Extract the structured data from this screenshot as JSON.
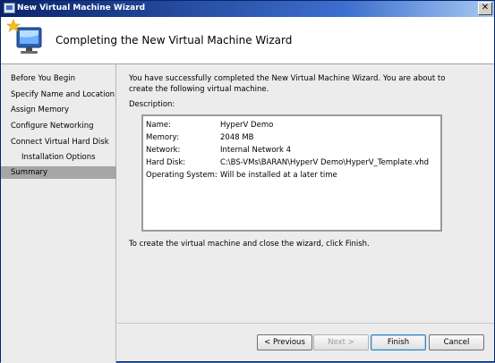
{
  "window": {
    "title": "New Virtual Machine Wizard",
    "close_glyph": "✕"
  },
  "header": {
    "icon": "new-virtual-machine-wizard-icon",
    "title": "Completing the New Virtual Machine Wizard"
  },
  "nav": {
    "items": [
      {
        "label": "Before You Begin"
      },
      {
        "label": "Specify Name and Location"
      },
      {
        "label": "Assign Memory"
      },
      {
        "label": "Configure Networking"
      },
      {
        "label": "Connect Virtual Hard Disk"
      },
      {
        "label": "Installation Options"
      },
      {
        "label": "Summary"
      }
    ],
    "selected": "Summary"
  },
  "main": {
    "intro": "You have successfully completed the New Virtual Machine Wizard. You are about to create the following virtual machine.",
    "description_label": "Description:",
    "summary": [
      {
        "key": "Name:",
        "value": "HyperV Demo"
      },
      {
        "key": "Memory:",
        "value": "2048 MB"
      },
      {
        "key": "Network:",
        "value": "Internal Network 4"
      },
      {
        "key": "Hard Disk:",
        "value": "C:\\BS-VMs\\BARAN\\HyperV Demo\\HyperV_Template.vhd"
      },
      {
        "key": "Operating System:",
        "value": "Will be installed at a later time"
      }
    ],
    "finish_text": "To create the virtual machine and close the wizard, click Finish."
  },
  "buttons": {
    "previous": "< Previous",
    "next": "Next >",
    "finish": "Finish",
    "cancel": "Cancel"
  },
  "colors": {
    "title_bar": "#0a246a",
    "selected_nav": "#a6a6a6",
    "window_background": "#ececec"
  }
}
